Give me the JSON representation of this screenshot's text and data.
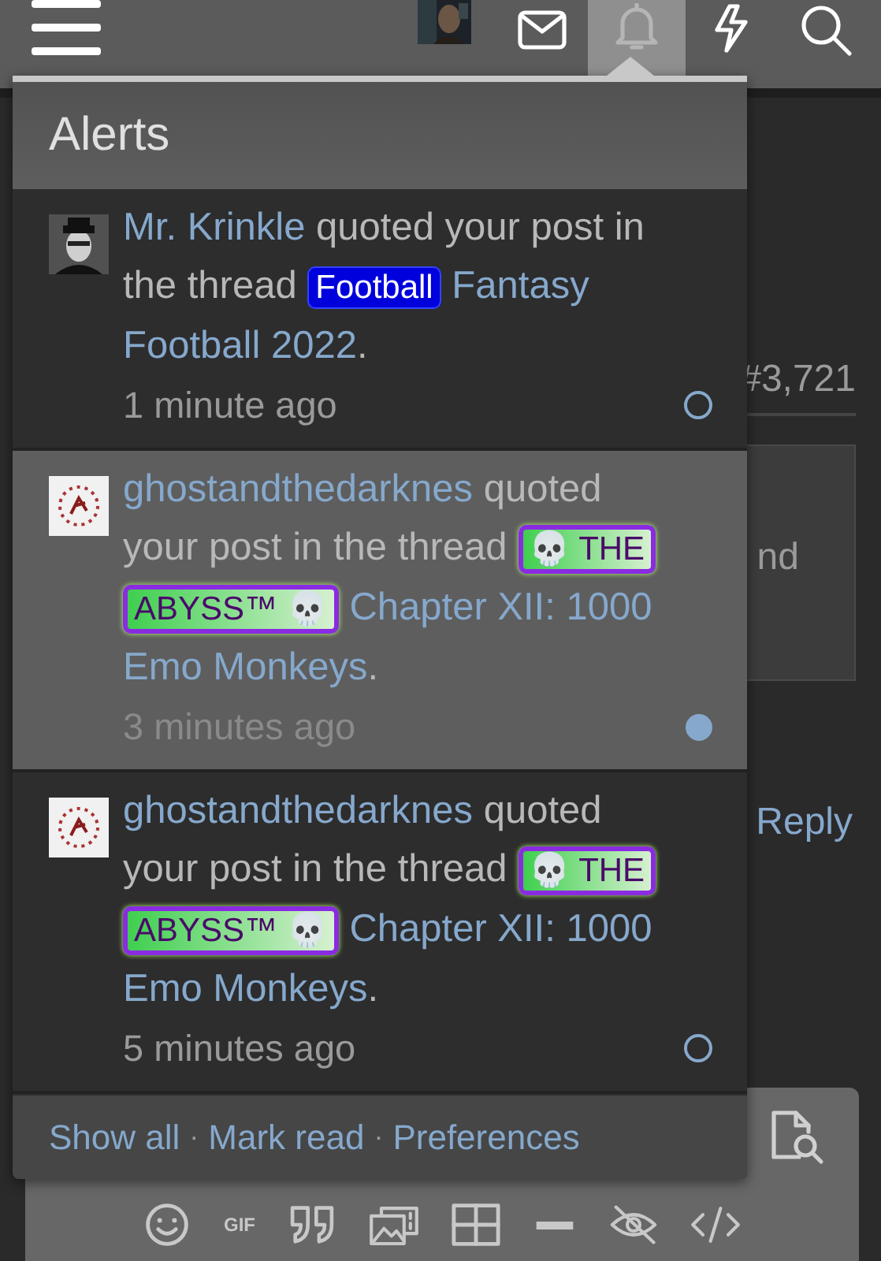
{
  "top_bar": {
    "alerts_open": true
  },
  "background": {
    "post_number": "#3,721",
    "partial_text": "nd",
    "reply_link": "Reply",
    "gif_button": "GIF"
  },
  "alerts": {
    "title": "Alerts",
    "items": [
      {
        "user": "Mr. Krinkle",
        "action": "quoted your post in the thread",
        "prefix": {
          "kind": "blue",
          "label": "Football"
        },
        "thread": "Fantasy Football 2022",
        "end": ".",
        "time": "1 minute ago",
        "avatar": {
          "kind": "portrait"
        },
        "unread": false
      },
      {
        "user": "ghostandthedarknes",
        "action": "quoted your post in the thread",
        "prefix": {
          "kind": "abyss",
          "label": "💀 THE ABYSS™ 💀"
        },
        "thread": "Chapter XII: 1000 Emo Monkeys",
        "end": ".",
        "time": "3 minutes ago",
        "avatar": {
          "kind": "emblem"
        },
        "unread": true
      },
      {
        "user": "ghostandthedarknes",
        "action": "quoted your post in the thread",
        "prefix": {
          "kind": "abyss",
          "label": "💀 THE ABYSS™ 💀"
        },
        "thread": "Chapter XII: 1000 Emo Monkeys",
        "end": ".",
        "time": "5 minutes ago",
        "avatar": {
          "kind": "emblem"
        },
        "unread": false
      }
    ],
    "footer_links": [
      "Show all",
      "Mark read",
      "Preferences"
    ],
    "separator": "·"
  }
}
